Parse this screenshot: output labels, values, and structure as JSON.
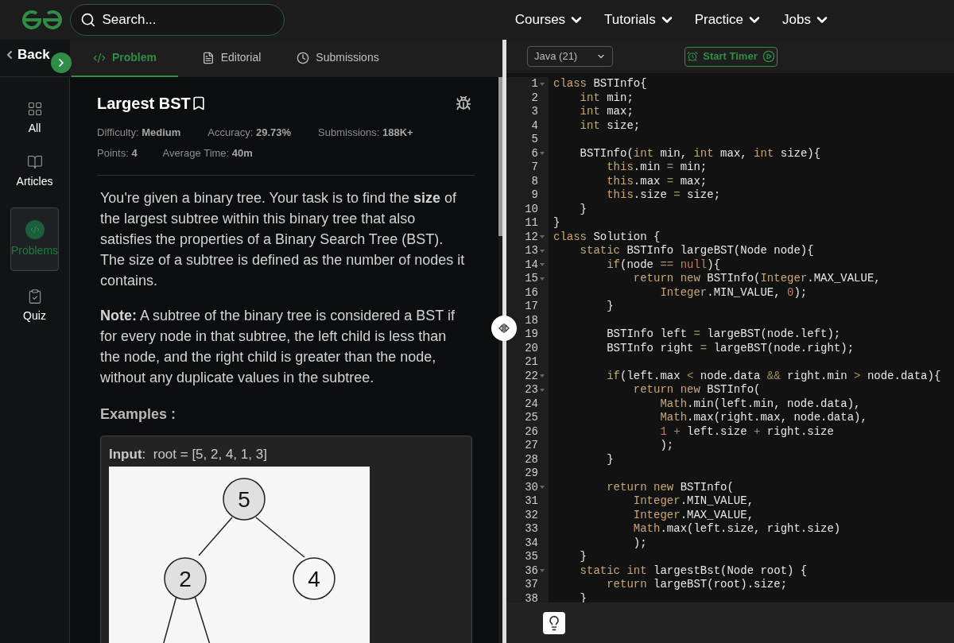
{
  "header": {
    "search": {
      "placeholder": "Search..."
    },
    "nav": [
      {
        "label": "Courses"
      },
      {
        "label": "Tutorials"
      },
      {
        "label": "Practice"
      },
      {
        "label": "Jobs"
      }
    ]
  },
  "sidebar": {
    "back": "Back",
    "items": [
      {
        "label": "All",
        "kind": "grid",
        "selected": false
      },
      {
        "label": "Articles",
        "kind": "book",
        "selected": false
      },
      {
        "label": "Problems",
        "kind": "code",
        "selected": true
      },
      {
        "label": "Quiz",
        "kind": "clipboard",
        "selected": false
      }
    ]
  },
  "tabs": [
    {
      "label": "Problem",
      "kind": "code",
      "selected": true
    },
    {
      "label": "Editorial",
      "kind": "doc",
      "selected": false
    },
    {
      "label": "Submissions",
      "kind": "clock",
      "selected": false
    }
  ],
  "problem": {
    "title": "Largest BST",
    "meta": [
      [
        {
          "label": "Difficulty:",
          "value": "Medium"
        },
        {
          "label": "Accuracy:",
          "value": "29.73%"
        },
        {
          "label": "Submissions:",
          "value": "188K+"
        }
      ],
      [
        {
          "label": "Points:",
          "value": "4"
        },
        {
          "label": "Average Time:",
          "value": "40m"
        }
      ]
    ],
    "paragraphs": [
      "You're given a binary tree. Your task is to find the **size** of the largest subtree within this binary tree that also satisfies the properties of a Binary Search Tree (BST). The size of a subtree is defined as the number of nodes it contains.",
      "**Note:** A subtree of the binary tree is considered a BST if for every node in that subtree, the left child is less than the node, and the right child is greater than the node, without any duplicate values in the subtree."
    ],
    "examples_heading": "Examples :",
    "example_input": "**Input**:  root = [5, 2, 4, 1, 3]",
    "tree": {
      "value": "5",
      "children": [
        {
          "value": "2"
        },
        {
          "value": "4"
        }
      ]
    }
  },
  "editor": {
    "language": "Java (21)",
    "timer_button": "Start Timer",
    "lines": [
      {
        "number": "1",
        "foldable": true,
        "tokens": [
          {
            "kind": "kw",
            "text": "class"
          },
          {
            "kind": "id",
            "text": " BSTInfo{"
          }
        ]
      },
      {
        "number": "2",
        "foldable": false,
        "tokens": [
          {
            "kind": "kw",
            "text": "    int"
          },
          {
            "kind": "id",
            "text": " min;"
          }
        ]
      },
      {
        "number": "3",
        "foldable": false,
        "tokens": [
          {
            "kind": "kw",
            "text": "    int"
          },
          {
            "kind": "id",
            "text": " max;"
          }
        ]
      },
      {
        "number": "4",
        "foldable": false,
        "tokens": [
          {
            "kind": "kw",
            "text": "    int"
          },
          {
            "kind": "id",
            "text": " size;"
          }
        ]
      },
      {
        "number": "5",
        "foldable": false
      },
      {
        "number": "6",
        "foldable": true,
        "tokens": [
          {
            "kind": "id",
            "text": "    BSTInfo("
          },
          {
            "kind": "kw",
            "text": "int"
          },
          {
            "kind": "id",
            "text": " min, "
          },
          {
            "kind": "kw",
            "text": "int"
          },
          {
            "kind": "id",
            "text": " max, "
          },
          {
            "kind": "kw",
            "text": "int"
          },
          {
            "kind": "id",
            "text": " size){"
          }
        ]
      },
      {
        "number": "7",
        "foldable": false,
        "tokens": [
          {
            "kind": "kw",
            "text": "        this"
          },
          {
            "kind": "id",
            "text": ".min "
          },
          {
            "kind": "op",
            "text": "="
          },
          {
            "kind": "id",
            "text": " min;"
          }
        ]
      },
      {
        "number": "8",
        "foldable": false,
        "tokens": [
          {
            "kind": "kw",
            "text": "        this"
          },
          {
            "kind": "id",
            "text": ".max "
          },
          {
            "kind": "op",
            "text": "="
          },
          {
            "kind": "id",
            "text": " max;"
          }
        ]
      },
      {
        "number": "9",
        "foldable": false,
        "tokens": [
          {
            "kind": "kw",
            "text": "        this"
          },
          {
            "kind": "id",
            "text": ".size "
          },
          {
            "kind": "op",
            "text": "="
          },
          {
            "kind": "id",
            "text": " size;"
          }
        ]
      },
      {
        "number": "10",
        "foldable": false,
        "tokens": [
          {
            "kind": "id",
            "text": "    }"
          }
        ]
      },
      {
        "number": "11",
        "foldable": false,
        "tokens": [
          {
            "kind": "id",
            "text": "}"
          }
        ]
      },
      {
        "number": "12",
        "foldable": true,
        "tokens": [
          {
            "kind": "kw",
            "text": "class"
          },
          {
            "kind": "id",
            "text": " Solution {"
          }
        ]
      },
      {
        "number": "13",
        "foldable": true,
        "tokens": [
          {
            "kind": "kw",
            "text": "    static"
          },
          {
            "kind": "id",
            "text": " BSTInfo largeBST(Node node){"
          }
        ]
      },
      {
        "number": "14",
        "foldable": true,
        "tokens": [
          {
            "kind": "kw",
            "text": "        if"
          },
          {
            "kind": "id",
            "text": "(node "
          },
          {
            "kind": "op",
            "text": "=="
          },
          {
            "kind": "lit",
            "text": " null"
          },
          {
            "kind": "id",
            "text": "){"
          }
        ]
      },
      {
        "number": "15",
        "foldable": true,
        "tokens": [
          {
            "kind": "kw",
            "text": "            return new"
          },
          {
            "kind": "id",
            "text": " BSTInfo("
          },
          {
            "kind": "kw",
            "text": "Integer"
          },
          {
            "kind": "id",
            "text": ".MAX_VALUE,"
          }
        ]
      },
      {
        "number": "16",
        "foldable": false,
        "tokens": [
          {
            "kind": "kw",
            "text": "                Integer"
          },
          {
            "kind": "id",
            "text": ".MIN_VALUE, "
          },
          {
            "kind": "lit",
            "text": "0"
          },
          {
            "kind": "id",
            "text": ");"
          }
        ]
      },
      {
        "number": "17",
        "foldable": false,
        "tokens": [
          {
            "kind": "id",
            "text": "        }"
          }
        ]
      },
      {
        "number": "18",
        "foldable": false
      },
      {
        "number": "19",
        "foldable": false,
        "tokens": [
          {
            "kind": "id",
            "text": "        BSTInfo left "
          },
          {
            "kind": "op",
            "text": "="
          },
          {
            "kind": "id",
            "text": " largeBST(node.left);"
          }
        ]
      },
      {
        "number": "20",
        "foldable": false,
        "tokens": [
          {
            "kind": "id",
            "text": "        BSTInfo right "
          },
          {
            "kind": "op",
            "text": "="
          },
          {
            "kind": "id",
            "text": " largeBST(node.right);"
          }
        ]
      },
      {
        "number": "21",
        "foldable": false
      },
      {
        "number": "22",
        "foldable": true,
        "tokens": [
          {
            "kind": "kw",
            "text": "        if"
          },
          {
            "kind": "id",
            "text": "(left.max "
          },
          {
            "kind": "op",
            "text": "<"
          },
          {
            "kind": "id",
            "text": " node.data "
          },
          {
            "kind": "op",
            "text": "&&"
          },
          {
            "kind": "id",
            "text": " right.min "
          },
          {
            "kind": "op",
            "text": ">"
          },
          {
            "kind": "id",
            "text": " node.data){"
          }
        ]
      },
      {
        "number": "23",
        "foldable": true,
        "tokens": [
          {
            "kind": "kw",
            "text": "            return new"
          },
          {
            "kind": "id",
            "text": " BSTInfo("
          }
        ]
      },
      {
        "number": "24",
        "foldable": false,
        "tokens": [
          {
            "kind": "kw",
            "text": "                Math"
          },
          {
            "kind": "id",
            "text": ".min(left.min, node.data),"
          }
        ]
      },
      {
        "number": "25",
        "foldable": false,
        "tokens": [
          {
            "kind": "kw",
            "text": "                Math"
          },
          {
            "kind": "id",
            "text": ".max(right.max, node.data),"
          }
        ]
      },
      {
        "number": "26",
        "foldable": false,
        "tokens": [
          {
            "kind": "lit",
            "text": "                1"
          },
          {
            "kind": "op",
            "text": " +"
          },
          {
            "kind": "id",
            "text": " left.size "
          },
          {
            "kind": "op",
            "text": "+"
          },
          {
            "kind": "id",
            "text": " right.size"
          }
        ]
      },
      {
        "number": "27",
        "foldable": false,
        "tokens": [
          {
            "kind": "id",
            "text": "                );"
          }
        ]
      },
      {
        "number": "28",
        "foldable": false,
        "tokens": [
          {
            "kind": "id",
            "text": "        }"
          }
        ]
      },
      {
        "number": "29",
        "foldable": false
      },
      {
        "number": "30",
        "foldable": true,
        "tokens": [
          {
            "kind": "kw",
            "text": "        return new"
          },
          {
            "kind": "id",
            "text": " BSTInfo("
          }
        ]
      },
      {
        "number": "31",
        "foldable": false,
        "tokens": [
          {
            "kind": "kw",
            "text": "            Integer"
          },
          {
            "kind": "id",
            "text": ".MIN_VALUE,"
          }
        ]
      },
      {
        "number": "32",
        "foldable": false,
        "tokens": [
          {
            "kind": "kw",
            "text": "            Integer"
          },
          {
            "kind": "id",
            "text": ".MAX_VALUE,"
          }
        ]
      },
      {
        "number": "33",
        "foldable": false,
        "tokens": [
          {
            "kind": "kw",
            "text": "            Math"
          },
          {
            "kind": "id",
            "text": ".max(left.size, right.size)"
          }
        ]
      },
      {
        "number": "34",
        "foldable": false,
        "tokens": [
          {
            "kind": "id",
            "text": "            );"
          }
        ]
      },
      {
        "number": "35",
        "foldable": false,
        "tokens": [
          {
            "kind": "id",
            "text": "    }"
          }
        ]
      },
      {
        "number": "36",
        "foldable": true,
        "tokens": [
          {
            "kind": "kw",
            "text": "    static int"
          },
          {
            "kind": "id",
            "text": " largestBst(Node root) {"
          }
        ]
      },
      {
        "number": "37",
        "foldable": false,
        "tokens": [
          {
            "kind": "kw",
            "text": "        return"
          },
          {
            "kind": "id",
            "text": " largeBST(root).size;"
          }
        ]
      },
      {
        "number": "38",
        "foldable": false,
        "tokens": [
          {
            "kind": "id",
            "text": "    }"
          }
        ]
      }
    ]
  }
}
